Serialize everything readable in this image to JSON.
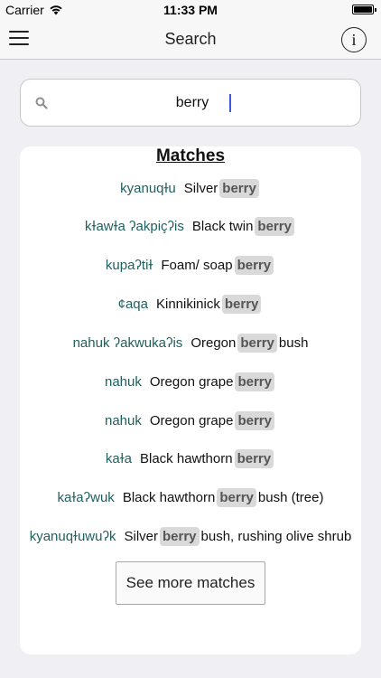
{
  "status": {
    "carrier": "Carrier",
    "time": "11:33 PM"
  },
  "nav": {
    "title": "Search",
    "info_glyph": "i"
  },
  "search": {
    "value": "berry",
    "placeholder": ""
  },
  "results": {
    "heading": "Matches",
    "rows": [
      {
        "native": "kyanuqɫu",
        "english_before": "Silver",
        "highlight": "berry",
        "english_after": ""
      },
      {
        "native": "kɫawɫa ʔakpiçʔis",
        "english_before": "Black twin",
        "highlight": "berry",
        "english_after": ""
      },
      {
        "native": "kupaʔtiɫ",
        "english_before": "Foam/ soap",
        "highlight": "berry",
        "english_after": ""
      },
      {
        "native": "¢aqa",
        "english_before": "Kinnikinick",
        "highlight": "berry",
        "english_after": ""
      },
      {
        "native": "nahuk ʔakwukaʔis",
        "english_before": "Oregon",
        "highlight": "berry",
        "english_after": "bush"
      },
      {
        "native": "nahuk",
        "english_before": "Oregon grape",
        "highlight": "berry",
        "english_after": ""
      },
      {
        "native": "nahuk",
        "english_before": "Oregon grape",
        "highlight": "berry",
        "english_after": ""
      },
      {
        "native": "kaɫa",
        "english_before": "Black hawthorn",
        "highlight": "berry",
        "english_after": ""
      },
      {
        "native": "kaɫaʔwuk",
        "english_before": "Black hawthorn",
        "highlight": "berry",
        "english_after": "bush (tree)"
      },
      {
        "native": "kyanuqɫuwuʔk",
        "english_before": "Silver",
        "highlight": "berry",
        "english_after": "bush, rushing olive shrub"
      }
    ],
    "more_button": "See more matches"
  }
}
